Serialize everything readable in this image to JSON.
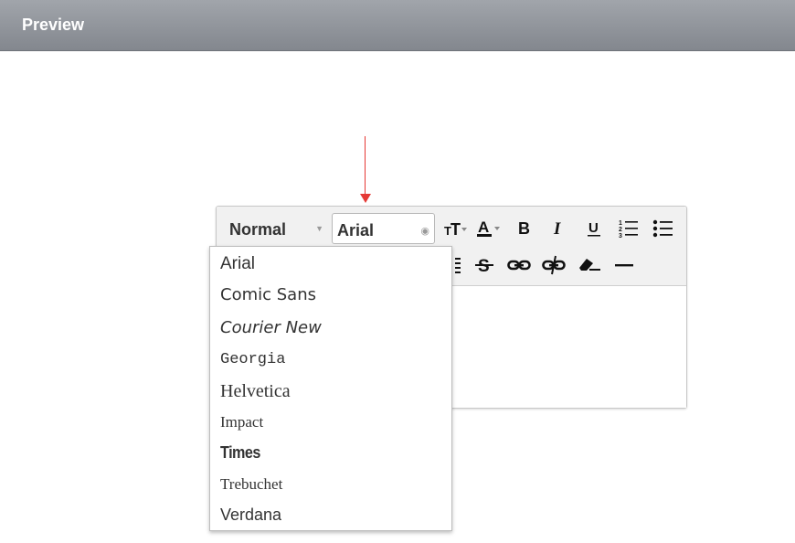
{
  "header": {
    "title": "Preview"
  },
  "editor": {
    "format_select": {
      "value": "Normal"
    },
    "font_select": {
      "value": "Arial"
    },
    "toolbar_icons": [
      "font-size-icon",
      "text-color-icon",
      "bold-icon",
      "italic-icon",
      "underline-icon",
      "ordered-list-icon",
      "bullet-list-icon",
      "align-icon",
      "strikethrough-icon",
      "link-icon",
      "unlink-icon",
      "clear-format-icon",
      "horizontal-rule-icon"
    ]
  },
  "font_dropdown": {
    "items": [
      "Arial",
      "Comic Sans",
      "Courier New",
      "Georgia",
      "Helvetica",
      "Impact",
      "Times",
      "Trebuchet",
      "Verdana"
    ]
  },
  "colors": {
    "header": "#8b9096",
    "annotation_arrow": "#e53935"
  }
}
